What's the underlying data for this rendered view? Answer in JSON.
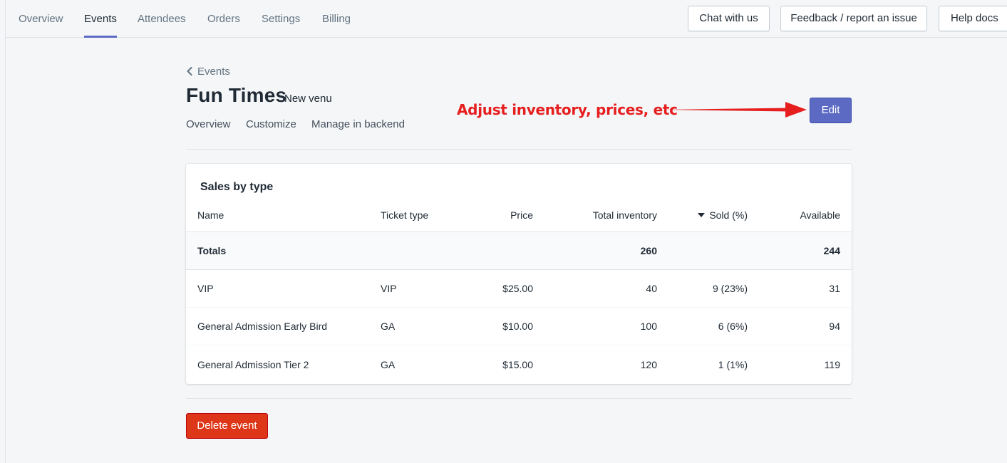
{
  "topnav": {
    "tabs": [
      {
        "label": "Overview",
        "active": false
      },
      {
        "label": "Events",
        "active": true
      },
      {
        "label": "Attendees",
        "active": false
      },
      {
        "label": "Orders",
        "active": false
      },
      {
        "label": "Settings",
        "active": false
      },
      {
        "label": "Billing",
        "active": false
      }
    ],
    "buttons": {
      "chat": "Chat with us",
      "feedback": "Feedback / report an issue",
      "help": "Help docs"
    }
  },
  "breadcrumb": {
    "label": "Events"
  },
  "event": {
    "title": "Fun Times",
    "venue": "New venu"
  },
  "subnav": [
    "Overview",
    "Customize",
    "Manage in backend"
  ],
  "annotation": {
    "text": "Adjust inventory, prices, etc",
    "color": "#e61e1e"
  },
  "edit_button": "Edit",
  "sales_card": {
    "title": "Sales by type",
    "columns": {
      "name": "Name",
      "ticket_type": "Ticket type",
      "price": "Price",
      "total_inventory": "Total inventory",
      "sold": "Sold (%)",
      "available": "Available"
    },
    "totals": {
      "label": "Totals",
      "total_inventory": "260",
      "available": "244"
    },
    "rows": [
      {
        "name": "VIP",
        "ticket_type": "VIP",
        "price": "$25.00",
        "total_inventory": "40",
        "sold": "9 (23%)",
        "available": "31"
      },
      {
        "name": "General Admission Early Bird",
        "ticket_type": "GA",
        "price": "$10.00",
        "total_inventory": "100",
        "sold": "6 (6%)",
        "available": "94"
      },
      {
        "name": "General Admission Tier 2",
        "ticket_type": "GA",
        "price": "$15.00",
        "total_inventory": "120",
        "sold": "1 (1%)",
        "available": "119"
      }
    ]
  },
  "delete_button": "Delete event",
  "colors": {
    "accent": "#5c6ac4",
    "danger": "#de3618",
    "background": "#f4f6f8"
  }
}
